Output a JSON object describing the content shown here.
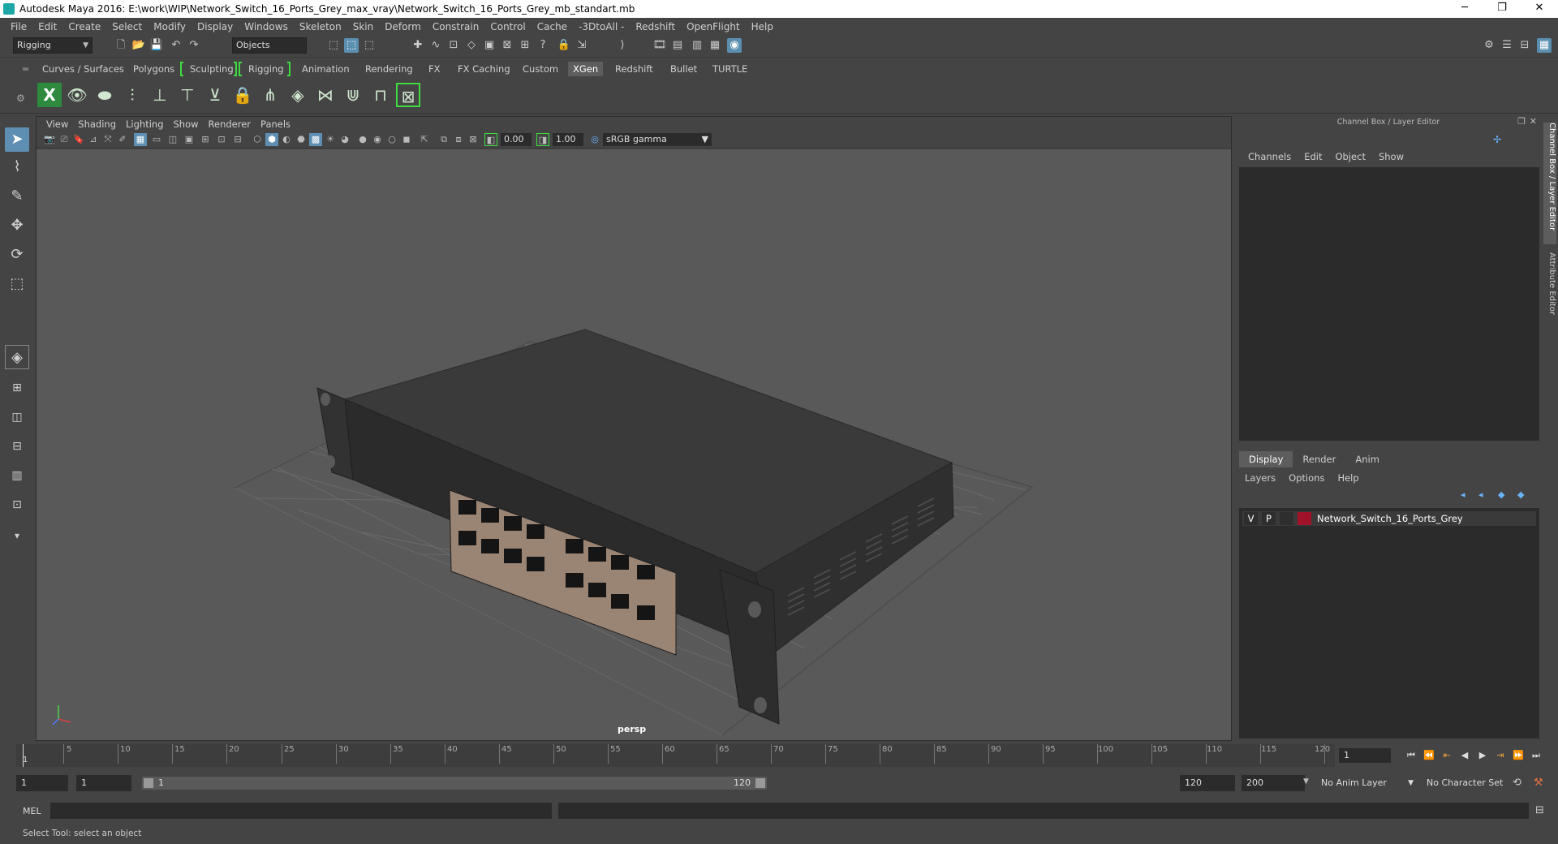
{
  "window": {
    "title": "Autodesk Maya 2016: E:\\work\\WIP\\Network_Switch_16_Ports_Grey_max_vray\\Network_Switch_16_Ports_Grey_mb_standart.mb"
  },
  "menubar": [
    "File",
    "Edit",
    "Create",
    "Select",
    "Modify",
    "Display",
    "Windows",
    "Skeleton",
    "Skin",
    "Deform",
    "Constrain",
    "Control",
    "Cache",
    "-3DtoAll -",
    "Redshift",
    "OpenFlight",
    "Help"
  ],
  "statusline": {
    "menuset": "Rigging",
    "selection_mode": "Objects"
  },
  "shelf_tabs": [
    "Curves / Surfaces",
    "Polygons",
    "Sculpting",
    "Rigging",
    "Animation",
    "Rendering",
    "FX",
    "FX Caching",
    "Custom",
    "XGen",
    "Redshift",
    "Bullet",
    "TURTLE"
  ],
  "shelf_active": "XGen",
  "viewport": {
    "menu": [
      "View",
      "Shading",
      "Lighting",
      "Show",
      "Renderer",
      "Panels"
    ],
    "exposure": "0.00",
    "gamma": "1.00",
    "color_space": "sRGB gamma",
    "camera_label": "persp"
  },
  "right_panel": {
    "title": "Channel Box / Layer Editor",
    "channel_menu": [
      "Channels",
      "Edit",
      "Object",
      "Show"
    ],
    "layer_tabs": [
      "Display",
      "Render",
      "Anim"
    ],
    "layer_active": "Display",
    "layer_menu": [
      "Layers",
      "Options",
      "Help"
    ],
    "layers": [
      {
        "v": "V",
        "p": "P",
        "name": "Network_Switch_16_Ports_Grey",
        "color": "#a0112a"
      }
    ],
    "side_tabs": [
      "Channel Box / Layer Editor",
      "Attribute Editor"
    ]
  },
  "timeline": {
    "ticks": [
      "5",
      "10",
      "15",
      "20",
      "25",
      "30",
      "35",
      "40",
      "45",
      "50",
      "55",
      "60",
      "65",
      "70",
      "75",
      "80",
      "85",
      "90",
      "95",
      "100",
      "105",
      "110",
      "115",
      "120"
    ],
    "start_label": "1",
    "current_frame": "1"
  },
  "range": {
    "start": "1",
    "playback_start": "1",
    "slider_start": "1",
    "slider_end": "120",
    "playback_end": "120",
    "end": "200",
    "anim_layer": "No Anim Layer",
    "character_set": "No Character Set"
  },
  "cmdline": {
    "label": "MEL"
  },
  "helpline": {
    "text": "Select Tool: select an object"
  },
  "colors": {
    "accent": "#5e8fb3",
    "shelf_bracket": "#3fdc3f",
    "viewport_bg": "#595959"
  }
}
